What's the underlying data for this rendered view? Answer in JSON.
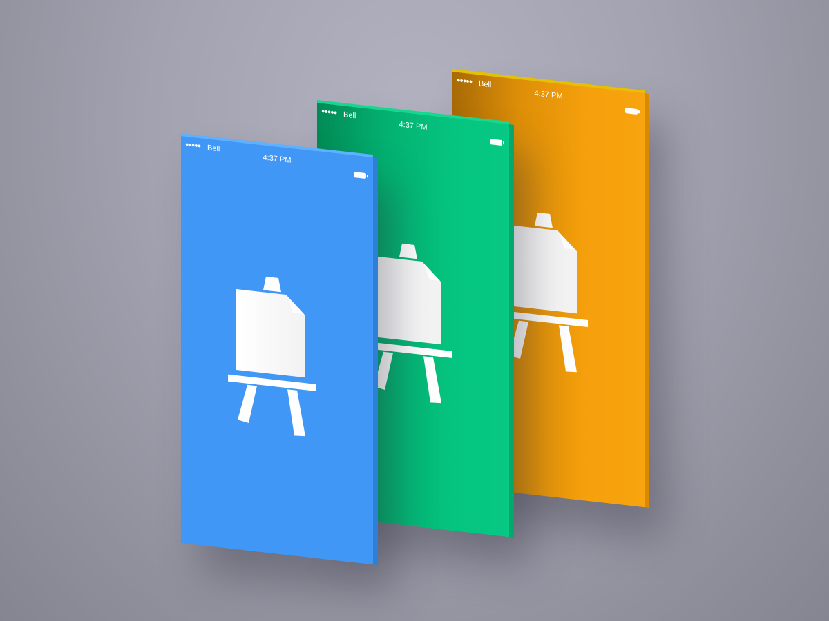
{
  "screens": [
    {
      "name": "orange",
      "color": "#f5a00c",
      "status": {
        "carrier": "Bell",
        "signal_dots": "●●●●●",
        "time": "4:37 PM"
      },
      "icon": "easel-icon"
    },
    {
      "name": "green",
      "color": "#05c47f",
      "status": {
        "carrier": "Bell",
        "signal_dots": "●●●●●",
        "time": "4:37 PM"
      },
      "icon": "easel-icon"
    },
    {
      "name": "blue",
      "color": "#4097f6",
      "status": {
        "carrier": "Bell",
        "signal_dots": "●●●●●",
        "time": "4:37 PM"
      },
      "icon": "easel-icon"
    }
  ]
}
